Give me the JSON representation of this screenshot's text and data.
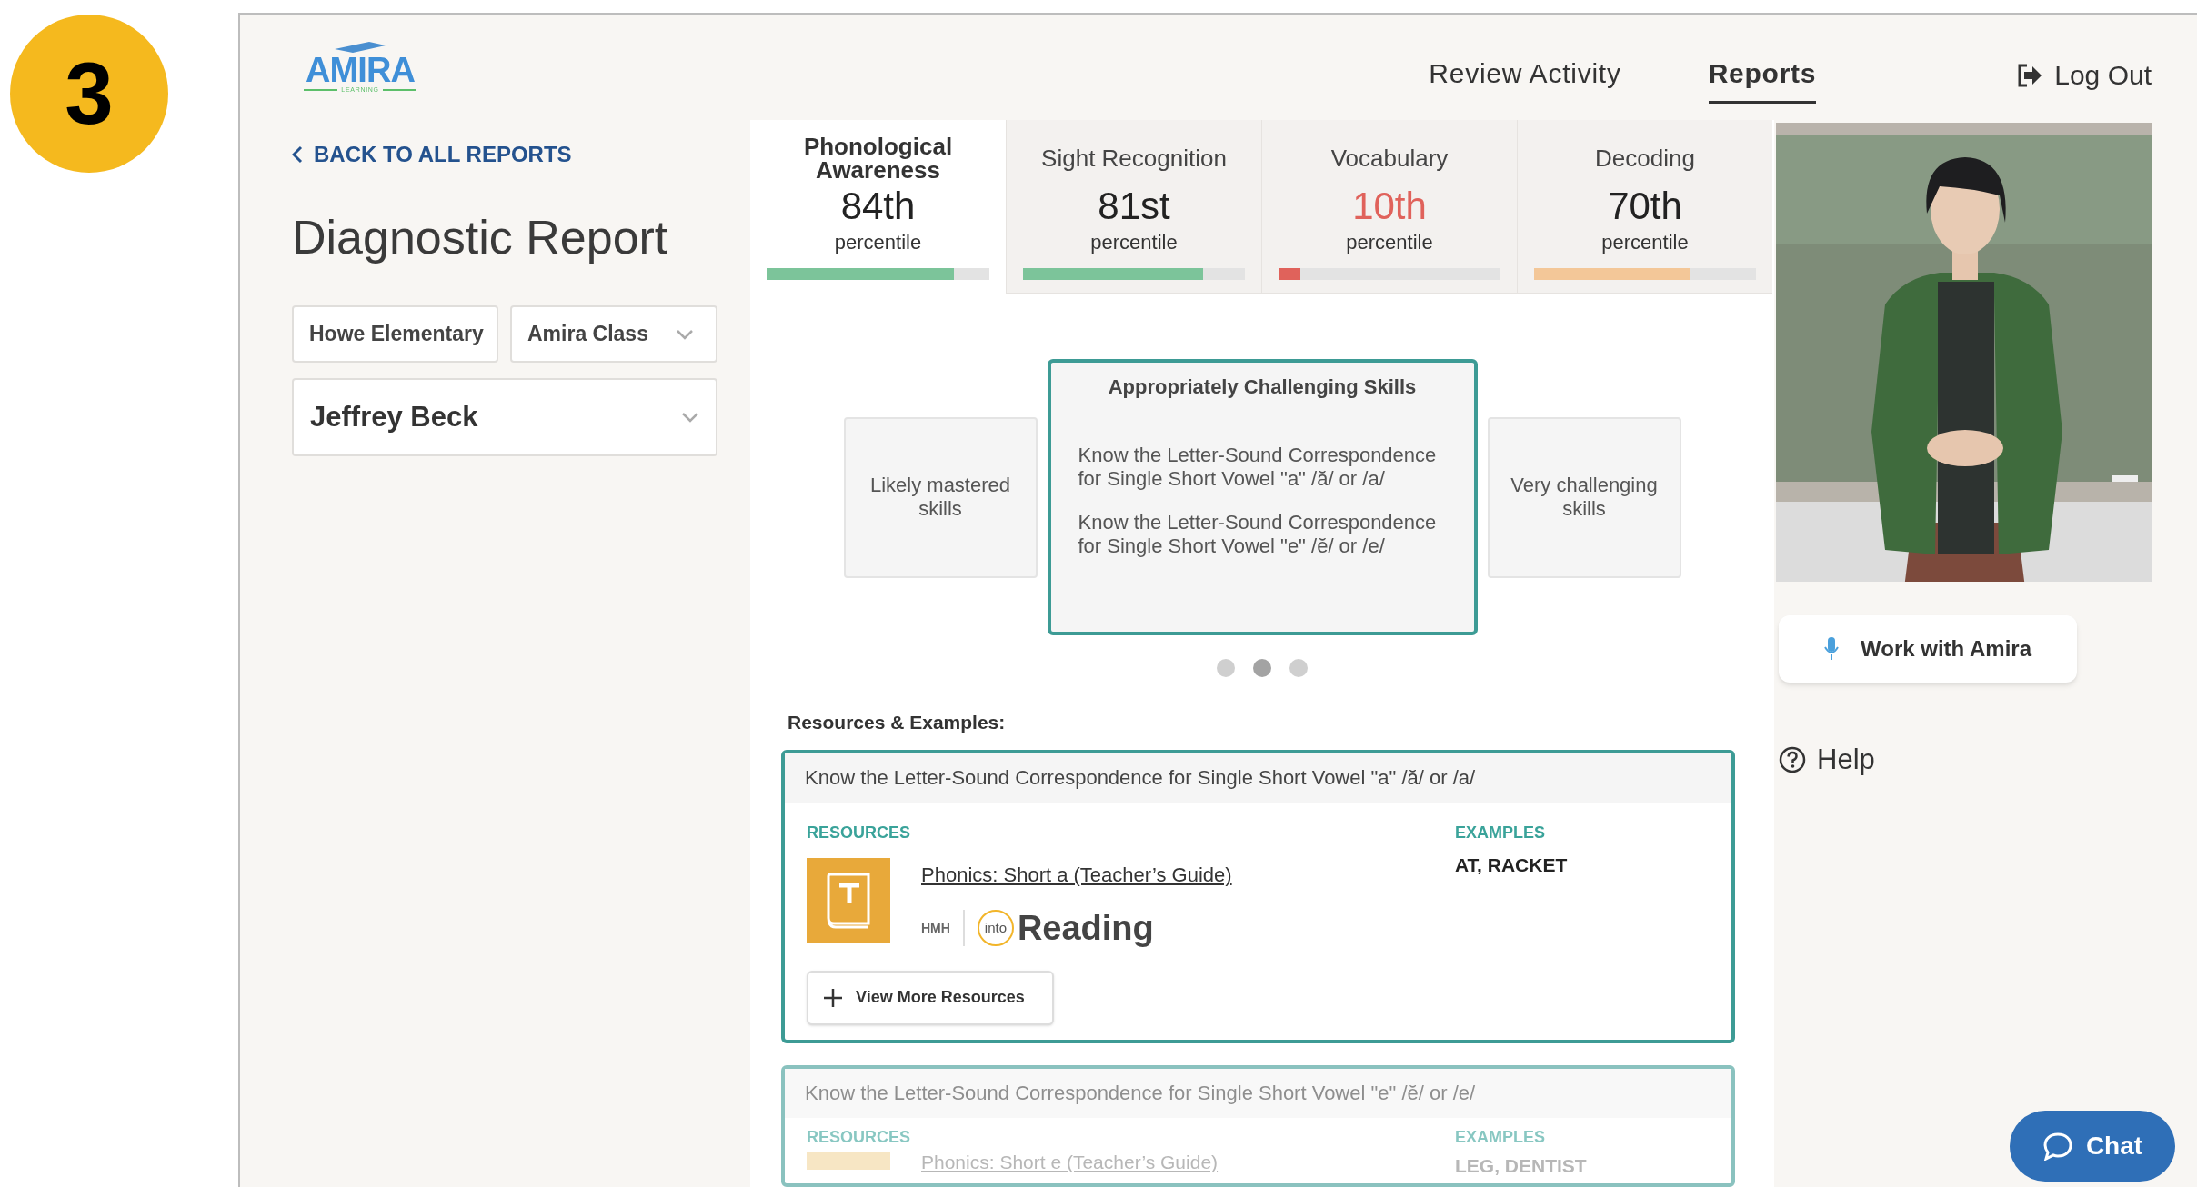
{
  "step_badge": "3",
  "logo": {
    "name": "AMIRA",
    "tagline": "LEARNING"
  },
  "nav": [
    {
      "label": "Review Activity",
      "selected": false
    },
    {
      "label": "Reports",
      "selected": true
    }
  ],
  "logout": "Log Out",
  "back_link": "BACK TO ALL REPORTS",
  "title": "Diagnostic Report",
  "filters": [
    {
      "value": "Howe Elementary",
      "dropdown": false
    },
    {
      "value": "Amira Class",
      "dropdown": true
    }
  ],
  "student": {
    "value": "Jeffrey Beck"
  },
  "score_tabs": [
    {
      "name": "Phonological Awareness",
      "score": "84th",
      "unit": "percentile",
      "level": 0.84,
      "color": "#7cc49a",
      "low": false,
      "selected": true
    },
    {
      "name": "Sight Recognition",
      "score": "81st",
      "unit": "percentile",
      "level": 0.81,
      "color": "#7cc49a",
      "low": false,
      "selected": false
    },
    {
      "name": "Vocabulary",
      "score": "10th",
      "unit": "percentile",
      "level": 0.1,
      "color": "#e0625b",
      "low": true,
      "selected": false
    },
    {
      "name": "Decoding",
      "score": "70th",
      "unit": "percentile",
      "level": 0.7,
      "color": "#f3c798",
      "low": false,
      "selected": false
    }
  ],
  "skill_cards": [
    {
      "kind": "side",
      "title": "Likely mastered skills"
    },
    {
      "kind": "center",
      "title": "Appropriately Challenging Skills",
      "skills": [
        "Know the Letter-Sound Correspondence for Single Short Vowel \"a\" /ă/ or /a/",
        "Know the Letter-Sound Correspondence for Single Short Vowel \"e\" /ĕ/ or /e/"
      ]
    },
    {
      "kind": "side",
      "title": "Very challenging skills"
    }
  ],
  "carousel_dots": [
    {
      "selected": false
    },
    {
      "selected": true
    },
    {
      "selected": false
    }
  ],
  "resources_heading": "Resources & Examples:",
  "resources": [
    {
      "skill": "Know the Letter-Sound Correspondence for Single Short Vowel \"a\" /ă/ or /a/",
      "resources_label": "RESOURCES",
      "resource_title": "Phonics: Short a (Teacher’s Guide)",
      "publisher": "HMH",
      "program_prefix": "into",
      "program": "Reading",
      "examples_label": "EXAMPLES",
      "examples": "AT, RACKET",
      "more_button": "View More Resources",
      "faded": false
    },
    {
      "skill": "Know the Letter-Sound Correspondence for Single Short Vowel \"e\" /ĕ/ or /e/",
      "resources_label": "RESOURCES",
      "resource_title": "Phonics: Short e (Teacher’s Guide)",
      "examples_label": "EXAMPLES",
      "examples": "LEG, DENTIST",
      "faded": true
    }
  ],
  "assistant_button": "Work with Amira",
  "help": "Help",
  "chat": "Chat"
}
